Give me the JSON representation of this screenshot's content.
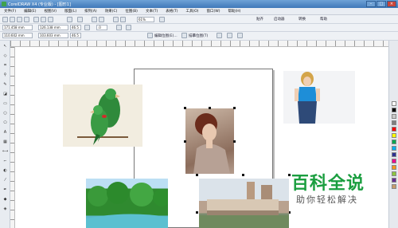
{
  "window": {
    "title": "CorelDRAW X4 (专业版) - [图形1]",
    "minimize_glyph": "–",
    "maximize_glyph": "□",
    "close_glyph": "×"
  },
  "menu": {
    "items": [
      "文件(F)",
      "编辑(E)",
      "视图(V)",
      "版面(L)",
      "排列(A)",
      "效果(C)",
      "位图(B)",
      "文本(T)",
      "表格(T)",
      "工具(O)",
      "窗口(W)",
      "帮助(H)"
    ]
  },
  "toolbar1": {
    "zoom_value": "61%",
    "snap_label": "贴齐",
    "launcher_label": "启动器",
    "convert_label": "转换",
    "help_label": "帮助"
  },
  "toolbar2": {
    "x_value": "171.458 mm",
    "y_value": "110.602 mm",
    "width_value": "126.138 mm",
    "height_value": "103.603 mm",
    "scale_x": "46.5",
    "scale_y": "46.5",
    "rotation": ".0",
    "edit_bitmap_label": "编辑位图(E)...",
    "trace_bitmap_label": "描摹位图(T)"
  },
  "watermark": {
    "title": "百科全说",
    "subtitle": "助你轻松解决"
  },
  "icons": {
    "app_logo": "coreldraw-logo-icon",
    "tools": [
      "pick-tool-icon",
      "shape-tool-icon",
      "crop-tool-icon",
      "zoom-tool-icon",
      "freehand-tool-icon",
      "smart-fill-icon",
      "rectangle-tool-icon",
      "ellipse-tool-icon",
      "polygon-tool-icon",
      "text-tool-icon",
      "table-tool-icon",
      "dimension-tool-icon",
      "connector-tool-icon",
      "blend-tool-icon",
      "eyedropper-icon",
      "outline-pen-icon",
      "fill-tool-icon",
      "interactive-fill-icon"
    ]
  },
  "colors": {
    "accent": "#1a9e3f",
    "titlebar": "#3f78b8",
    "palette": [
      "#ffffff",
      "#000000",
      "#c8c8c8",
      "#7f7f7f",
      "#ff0000",
      "#ffff00",
      "#00a651",
      "#00aeef",
      "#2e3192",
      "#ec008c",
      "#f7941d",
      "#8dc63f",
      "#662d91",
      "#c69c6d"
    ]
  }
}
